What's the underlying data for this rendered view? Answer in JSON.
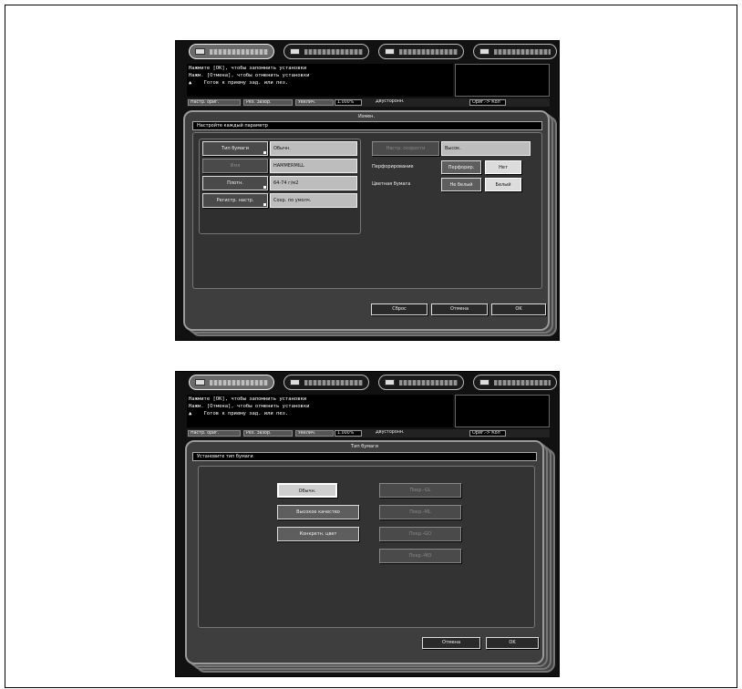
{
  "tabs": [
    "Копир.",
    "Сканиров.",
    "Сохр. док.",
    "Машина"
  ],
  "message": {
    "line1": "Нажмите [OK], чтобы запомнить установки",
    "line2": "Нажм. [Отмена], чтобы отменить установки",
    "line3": "Готов к приему зад. или пез."
  },
  "status_bar": {
    "f1": "Настр. ориг.",
    "f2": "Рез. Зазор.",
    "f3": "Увелич.",
    "f4": "1.000%",
    "f5": "Двусторонн.",
    "f6": "Ориг.-> Кол"
  },
  "screen1": {
    "title": "Измен.",
    "instruction": "Настройте каждый параметр",
    "rows": [
      {
        "label": "Тип бумаги",
        "value": "Обычн."
      },
      {
        "label": "Имя",
        "value": "HAMMERMILL"
      },
      {
        "label": "Плотн.",
        "value": "64-74 г/м2"
      },
      {
        "label": "Регистр. настр.",
        "value": "Сохр. по умолч."
      }
    ],
    "right": {
      "quality_label": "Настр. скорости",
      "quality_value": "Высок.",
      "perf_label": "Перфорирование",
      "perf_btn": "Перфорир.",
      "perf_value": "Нет",
      "color_label": "Цветная бумага",
      "color_btn": "Не белый",
      "color_value": "Белый"
    },
    "footer": {
      "reset": "Сброс",
      "cancel": "Отмена",
      "ok": "OK"
    }
  },
  "screen2": {
    "title": "Тип бумаги",
    "instruction": "Установите тип бумаги",
    "left_buttons": [
      "Обычн.",
      "Высокое качество",
      "Конкретн. цвет"
    ],
    "right_buttons": [
      "Покр.-GL",
      "Покр.-ML",
      "Покр.-GO",
      "Покр.-MO"
    ],
    "footer": {
      "cancel": "Отмена",
      "ok": "OK"
    }
  }
}
